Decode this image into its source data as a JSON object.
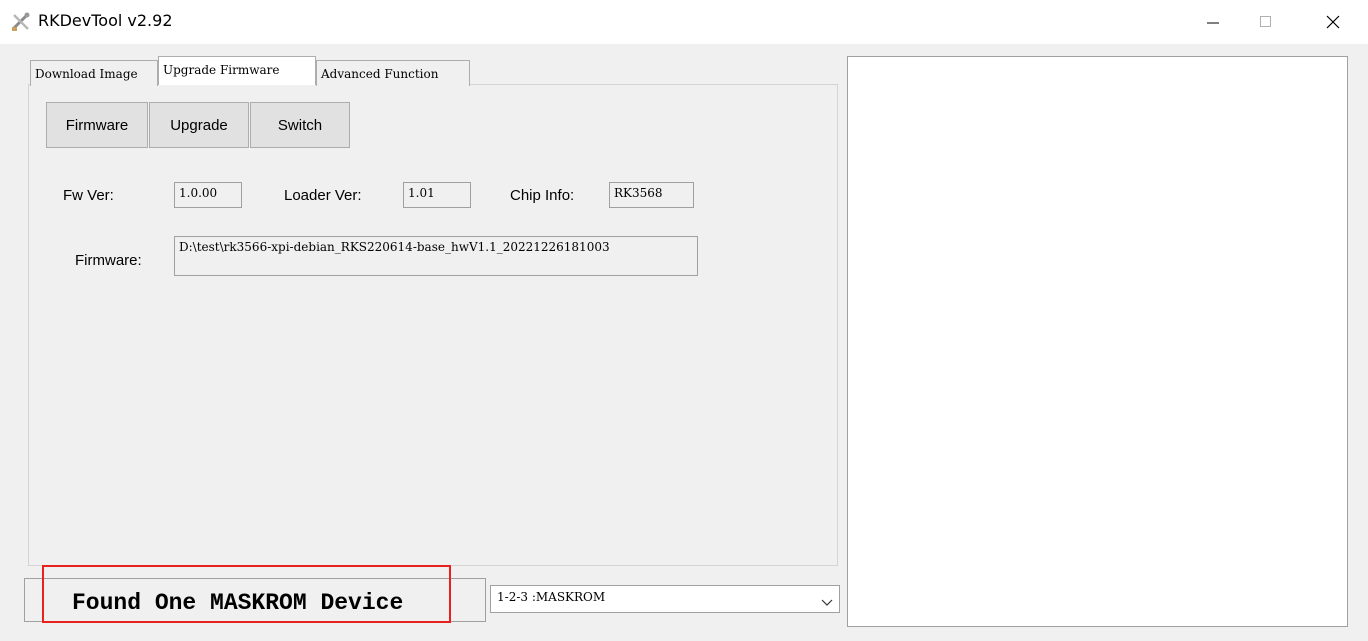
{
  "window": {
    "title": "RKDevTool v2.92",
    "controls": {
      "minimize": "—",
      "maximize": "☐",
      "close": "✕"
    }
  },
  "tabs": [
    {
      "label": "Download Image",
      "active": false
    },
    {
      "label": "Upgrade Firmware",
      "active": true
    },
    {
      "label": "Advanced Function",
      "active": false
    }
  ],
  "toolbar": {
    "firmware_label": "Firmware",
    "upgrade_label": "Upgrade",
    "switch_label": "Switch"
  },
  "info": {
    "fw_ver_label": "Fw Ver:",
    "fw_ver_value": "1.0.00",
    "loader_ver_label": "Loader Ver:",
    "loader_ver_value": "1.01",
    "chip_info_label": "Chip Info:",
    "chip_info_value": "RK3568",
    "firmware_label": "Firmware:",
    "firmware_path": "D:\\test\\rk3566-xpi-debian_RKS220614-base_hwV1.1_20221226181003"
  },
  "status": {
    "message": "Found One MASKROM Device",
    "highlight_color": "#e8201e"
  },
  "device_select": {
    "selected": "1-2-3 :MASKROM"
  }
}
